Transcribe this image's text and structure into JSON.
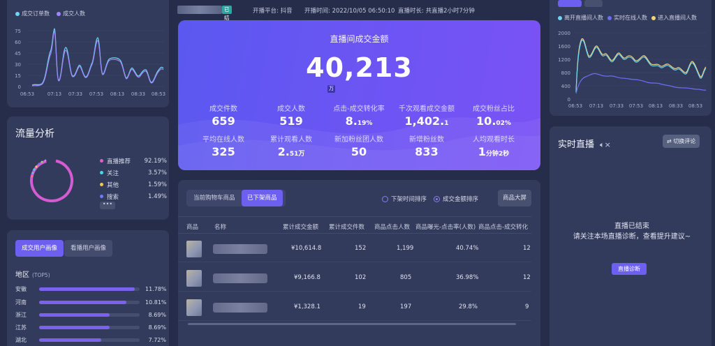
{
  "left_chart": {
    "legend": [
      "成交订单数",
      "成交人数"
    ],
    "colors": [
      "#6fd4f0",
      "#9f86ff"
    ],
    "y_ticks": [
      "75",
      "60",
      "45",
      "30",
      "15",
      "0"
    ],
    "x_ticks": [
      "06:53",
      "07:13",
      "07:33",
      "07:53",
      "08:13",
      "08:33",
      "08:53"
    ]
  },
  "traffic": {
    "title": "流量分析",
    "items": [
      {
        "label": "直播推荐",
        "pct": "92.19%",
        "color": "#e05ec7"
      },
      {
        "label": "关注",
        "pct": "3.57%",
        "color": "#4ad6e6"
      },
      {
        "label": "其他",
        "pct": "1.59%",
        "color": "#f1c84b"
      },
      {
        "label": "搜索",
        "pct": "1.49%",
        "color": "#6c7cf6"
      }
    ],
    "more": "•••"
  },
  "portrait": {
    "tabs": [
      "成交用户画像",
      "看播用户画像"
    ],
    "region_title": "地区",
    "region_sub": "(TOP5)",
    "regions": [
      {
        "name": "安徽",
        "pct": "11.78%",
        "value": 0.95
      },
      {
        "name": "河南",
        "pct": "10.81%",
        "value": 0.87
      },
      {
        "name": "浙江",
        "pct": "8.69%",
        "value": 0.7
      },
      {
        "name": "江苏",
        "pct": "8.69%",
        "value": 0.7
      },
      {
        "name": "湖北",
        "pct": "7.72%",
        "value": 0.62
      }
    ]
  },
  "topbar": {
    "status": "已结束",
    "platform": "开播平台: 抖音",
    "start_time": "开播时间: 2022/10/05 06:50:10",
    "duration": "直播时长: 共直播2小时7分钟"
  },
  "kpi": {
    "title": "直播间成交金额",
    "amount": "40,213",
    "unit": "万",
    "cells": [
      {
        "label": "成交件数",
        "value": "659",
        "suffix": ""
      },
      {
        "label": "成交人数",
        "value": "519",
        "suffix": ""
      },
      {
        "label": "点击-成交转化率",
        "value": "8.",
        "suffix": "19%"
      },
      {
        "label": "千次观看成交金额",
        "value": "1,402.",
        "suffix": "1"
      },
      {
        "label": "成交粉丝占比",
        "value": "10.",
        "suffix": "02%"
      },
      {
        "label": "平均在线人数",
        "value": "325",
        "suffix": ""
      },
      {
        "label": "累计观看人数",
        "value": "2.",
        "suffix": "51万"
      },
      {
        "label": "新加粉丝团人数",
        "value": "50",
        "suffix": ""
      },
      {
        "label": "新增粉丝数",
        "value": "833",
        "suffix": ""
      },
      {
        "label": "人均观看时长",
        "value": "1",
        "suffix": "分钟2秒"
      }
    ]
  },
  "products": {
    "tabs": [
      "当前购物车商品",
      "已下架商品"
    ],
    "sort_options": [
      "下架时间排序",
      "成交金额排序"
    ],
    "big_screen": "商品大屏",
    "headers": [
      "商品",
      "名称",
      "累计成交金额",
      "累计成交件数",
      "商品点击人数",
      "商品曝光-点击率(人数)",
      "商品点击-成交转化"
    ],
    "rows": [
      {
        "amount": "¥10,614.8",
        "count": "152",
        "clicks": "1,199",
        "ctr": "40.74%",
        "conv": "12"
      },
      {
        "amount": "¥9,166.8",
        "count": "102",
        "clicks": "805",
        "ctr": "36.98%",
        "conv": "12"
      },
      {
        "amount": "¥1,328.1",
        "count": "19",
        "clicks": "197",
        "ctr": "29.8%",
        "conv": "9"
      }
    ]
  },
  "right_chart": {
    "legend": [
      "离开直播间人数",
      "实时在线人数",
      "进入直播间人数"
    ],
    "colors": [
      "#6fd4f0",
      "#6c6cf4",
      "#f1d37a"
    ],
    "y_ticks": [
      "2000",
      "1600",
      "1200",
      "800",
      "400",
      "0"
    ],
    "x_ticks": [
      "06:53",
      "07:13",
      "07:33",
      "07:53",
      "08:13",
      "08:33",
      "08:53"
    ]
  },
  "live": {
    "title": "实时直播",
    "switch": "⇄ 切换评论",
    "message": "直播已结束\n请关注本场直播诊断，查看提升建议~",
    "diag": "直播诊断"
  }
}
